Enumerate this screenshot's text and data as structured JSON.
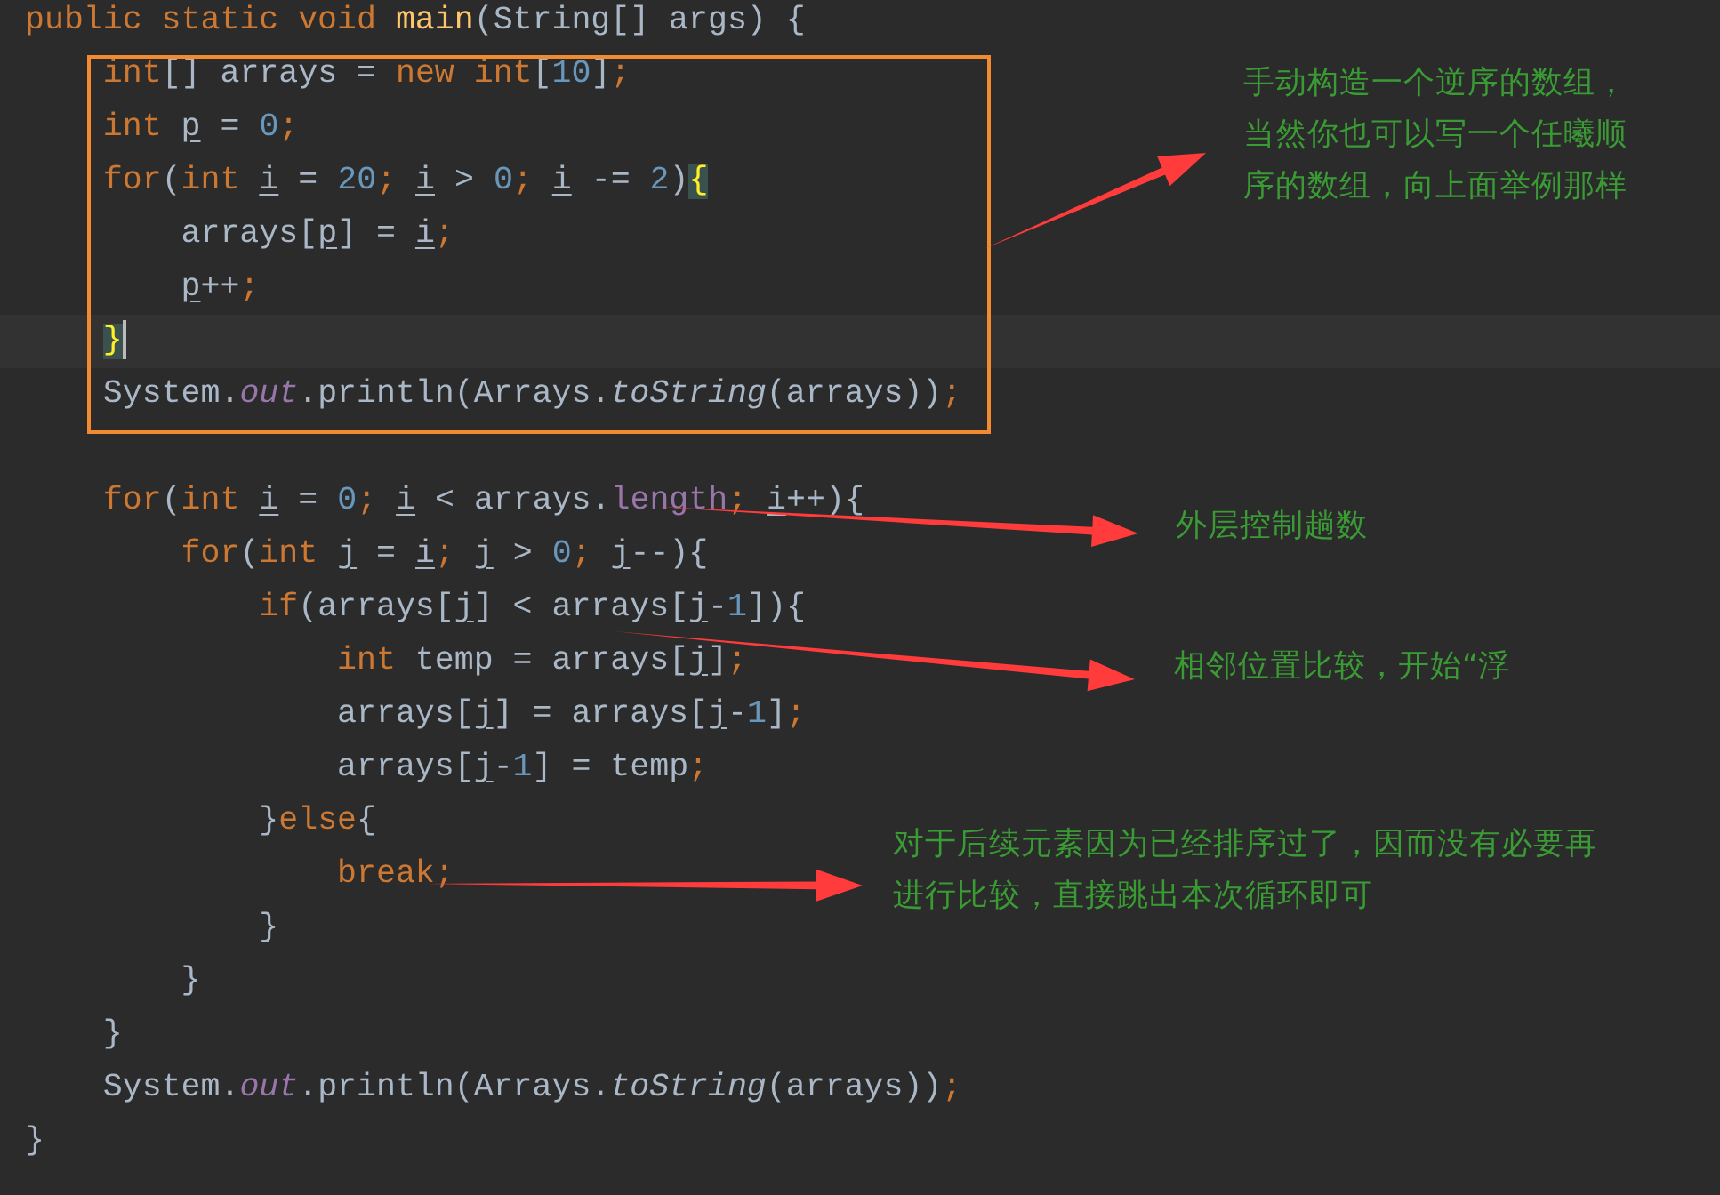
{
  "code": {
    "lines": [
      {
        "current": false,
        "tokens": [
          {
            "t": "public static void ",
            "kind": "kw"
          },
          {
            "t": "main",
            "kind": "fn"
          },
          {
            "t": "(String[] args) {",
            "kind": "plain"
          }
        ]
      },
      {
        "current": false,
        "tokens": [
          {
            "t": "    int",
            "kind": "kw"
          },
          {
            "t": "[] arrays = ",
            "kind": "plain"
          },
          {
            "t": "new int",
            "kind": "kw"
          },
          {
            "t": "[",
            "kind": "plain"
          },
          {
            "t": "10",
            "kind": "num"
          },
          {
            "t": "]",
            "kind": "plain"
          },
          {
            "t": ";",
            "kind": "kw"
          }
        ]
      },
      {
        "current": false,
        "tokens": [
          {
            "t": "    int ",
            "kind": "kw"
          },
          {
            "t": "p",
            "kind": "var"
          },
          {
            "t": " = ",
            "kind": "plain"
          },
          {
            "t": "0",
            "kind": "num"
          },
          {
            "t": ";",
            "kind": "kw"
          }
        ]
      },
      {
        "current": false,
        "tokens": [
          {
            "t": "    for",
            "kind": "kw"
          },
          {
            "t": "(",
            "kind": "plain"
          },
          {
            "t": "int ",
            "kind": "kw"
          },
          {
            "t": "i",
            "kind": "var"
          },
          {
            "t": " = ",
            "kind": "plain"
          },
          {
            "t": "20",
            "kind": "num"
          },
          {
            "t": "; ",
            "kind": "kw"
          },
          {
            "t": "i",
            "kind": "var"
          },
          {
            "t": " > ",
            "kind": "plain"
          },
          {
            "t": "0",
            "kind": "num"
          },
          {
            "t": "; ",
            "kind": "kw"
          },
          {
            "t": "i",
            "kind": "var"
          },
          {
            "t": " -= ",
            "kind": "plain"
          },
          {
            "t": "2",
            "kind": "num"
          },
          {
            "t": ")",
            "kind": "plain"
          },
          {
            "t": "{",
            "kind": "brace"
          }
        ]
      },
      {
        "current": false,
        "tokens": [
          {
            "t": "        arrays[",
            "kind": "plain"
          },
          {
            "t": "p",
            "kind": "var"
          },
          {
            "t": "] = ",
            "kind": "plain"
          },
          {
            "t": "i",
            "kind": "var"
          },
          {
            "t": ";",
            "kind": "kw"
          }
        ]
      },
      {
        "current": false,
        "tokens": [
          {
            "t": "        p",
            "kind": "var"
          },
          {
            "t": "++",
            "kind": "plain"
          },
          {
            "t": ";",
            "kind": "kw"
          }
        ]
      },
      {
        "current": true,
        "tokens": [
          {
            "t": "    }",
            "kind": "brace"
          }
        ]
      },
      {
        "current": false,
        "tokens": [
          {
            "t": "    System.",
            "kind": "plain"
          },
          {
            "t": "out",
            "kind": "field"
          },
          {
            "t": ".println(Arrays.",
            "kind": "plain"
          },
          {
            "t": "toString",
            "kind": "static"
          },
          {
            "t": "(arrays))",
            "kind": "plain"
          },
          {
            "t": ";",
            "kind": "kw"
          }
        ]
      },
      {
        "current": false
      },
      {
        "current": false,
        "tokens": [
          {
            "t": "    for",
            "kind": "kw"
          },
          {
            "t": "(",
            "kind": "plain"
          },
          {
            "t": "int ",
            "kind": "kw"
          },
          {
            "t": "i",
            "kind": "var"
          },
          {
            "t": " = ",
            "kind": "plain"
          },
          {
            "t": "0",
            "kind": "num"
          },
          {
            "t": "; ",
            "kind": "kw"
          },
          {
            "t": "i",
            "kind": "var"
          },
          {
            "t": " < arrays.",
            "kind": "plain"
          },
          {
            "t": "length",
            "kind": "prop"
          },
          {
            "t": "; ",
            "kind": "kw"
          },
          {
            "t": "i",
            "kind": "var"
          },
          {
            "t": "++){",
            "kind": "plain"
          }
        ]
      },
      {
        "current": false,
        "tokens": [
          {
            "t": "        for",
            "kind": "kw"
          },
          {
            "t": "(",
            "kind": "plain"
          },
          {
            "t": "int ",
            "kind": "kw"
          },
          {
            "t": "j",
            "kind": "var"
          },
          {
            "t": " = ",
            "kind": "plain"
          },
          {
            "t": "i",
            "kind": "var"
          },
          {
            "t": "; ",
            "kind": "kw"
          },
          {
            "t": "j",
            "kind": "var"
          },
          {
            "t": " > ",
            "kind": "plain"
          },
          {
            "t": "0",
            "kind": "num"
          },
          {
            "t": "; ",
            "kind": "kw"
          },
          {
            "t": "j",
            "kind": "var"
          },
          {
            "t": "--){",
            "kind": "plain"
          }
        ]
      },
      {
        "current": false,
        "tokens": [
          {
            "t": "            if",
            "kind": "kw"
          },
          {
            "t": "(arrays[",
            "kind": "plain"
          },
          {
            "t": "j",
            "kind": "var"
          },
          {
            "t": "] < arrays[",
            "kind": "plain"
          },
          {
            "t": "j",
            "kind": "var"
          },
          {
            "t": "-",
            "kind": "plain"
          },
          {
            "t": "1",
            "kind": "num"
          },
          {
            "t": "]){",
            "kind": "plain"
          }
        ]
      },
      {
        "current": false,
        "tokens": [
          {
            "t": "                int ",
            "kind": "kw"
          },
          {
            "t": "temp = arrays[",
            "kind": "plain"
          },
          {
            "t": "j",
            "kind": "var"
          },
          {
            "t": "]",
            "kind": "plain"
          },
          {
            "t": ";",
            "kind": "kw"
          }
        ]
      },
      {
        "current": false,
        "tokens": [
          {
            "t": "                arrays[",
            "kind": "plain"
          },
          {
            "t": "j",
            "kind": "var"
          },
          {
            "t": "] = arrays[",
            "kind": "plain"
          },
          {
            "t": "j",
            "kind": "var"
          },
          {
            "t": "-",
            "kind": "plain"
          },
          {
            "t": "1",
            "kind": "num"
          },
          {
            "t": "]",
            "kind": "plain"
          },
          {
            "t": ";",
            "kind": "kw"
          }
        ]
      },
      {
        "current": false,
        "tokens": [
          {
            "t": "                arrays[",
            "kind": "plain"
          },
          {
            "t": "j",
            "kind": "var"
          },
          {
            "t": "-",
            "kind": "plain"
          },
          {
            "t": "1",
            "kind": "num"
          },
          {
            "t": "] = temp",
            "kind": "plain"
          },
          {
            "t": ";",
            "kind": "kw"
          }
        ]
      },
      {
        "current": false,
        "tokens": [
          {
            "t": "            }",
            "kind": "plain"
          },
          {
            "t": "else",
            "kind": "kw"
          },
          {
            "t": "{",
            "kind": "plain"
          }
        ]
      },
      {
        "current": false,
        "tokens": [
          {
            "t": "                break;",
            "kind": "kw"
          }
        ]
      },
      {
        "current": false,
        "tokens": [
          {
            "t": "            }",
            "kind": "plain"
          }
        ]
      },
      {
        "current": false,
        "tokens": [
          {
            "t": "        }",
            "kind": "plain"
          }
        ]
      },
      {
        "current": false,
        "tokens": [
          {
            "t": "    }",
            "kind": "plain"
          }
        ]
      },
      {
        "current": false,
        "tokens": [
          {
            "t": "    System.",
            "kind": "plain"
          },
          {
            "t": "out",
            "kind": "field"
          },
          {
            "t": ".println(Arrays.",
            "kind": "plain"
          },
          {
            "t": "toString",
            "kind": "static"
          },
          {
            "t": "(arrays))",
            "kind": "plain"
          },
          {
            "t": ";",
            "kind": "kw"
          }
        ]
      },
      {
        "current": false,
        "tokens": [
          {
            "t": "}",
            "kind": "plain"
          }
        ]
      }
    ]
  },
  "annotations": [
    {
      "lines": [
        "手动构造一个逆序的数组，",
        "当然你也可以写一个任曦顺",
        "序的数组，向上面举例那样"
      ]
    },
    {
      "lines": [
        "外层控制趟数"
      ]
    },
    {
      "lines": [
        "相邻位置比较，开始“浮"
      ]
    },
    {
      "lines": [
        "对于后续元素因为已经排序过了，因而没有必要再",
        "进行比较，直接跳出本次循环即可"
      ]
    }
  ]
}
